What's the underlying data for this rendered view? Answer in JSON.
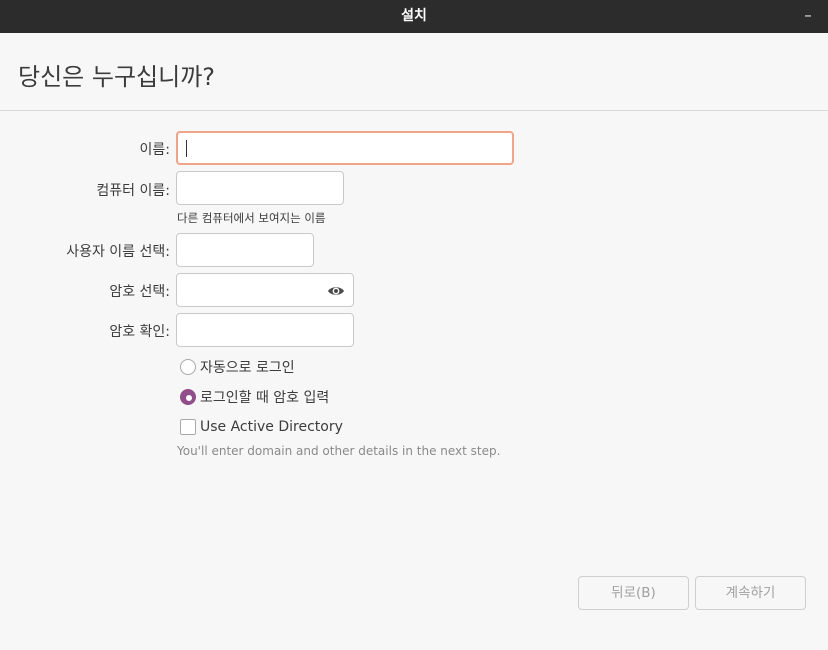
{
  "window": {
    "title": "설치",
    "minimize_symbol": "–"
  },
  "page": {
    "title": "당신은 누구십니까?"
  },
  "form": {
    "name": {
      "label": "이름:",
      "value": ""
    },
    "computer_name": {
      "label": "컴퓨터 이름:",
      "value": "",
      "hint": "다른 컴퓨터에서 보여지는 이름"
    },
    "username": {
      "label": "사용자 이름 선택:",
      "value": ""
    },
    "password": {
      "label": "암호 선택:",
      "value": "",
      "reveal_icon": "eye-icon"
    },
    "confirm_password": {
      "label": "암호 확인:",
      "value": ""
    }
  },
  "options": {
    "auto_login": {
      "label": "자동으로 로그인",
      "selected": false
    },
    "require_password": {
      "label": "로그인할 때 암호 입력",
      "selected": true
    },
    "active_directory": {
      "label": "Use Active Directory",
      "checked": false,
      "note": "You'll enter domain and other details in the next step."
    }
  },
  "buttons": {
    "back": "뒤로(B)",
    "continue": "계속하기"
  },
  "colors": {
    "titlebar": "#2c2c2c",
    "accent_radio": "#924d8b",
    "focus_border": "#f0a58a"
  }
}
